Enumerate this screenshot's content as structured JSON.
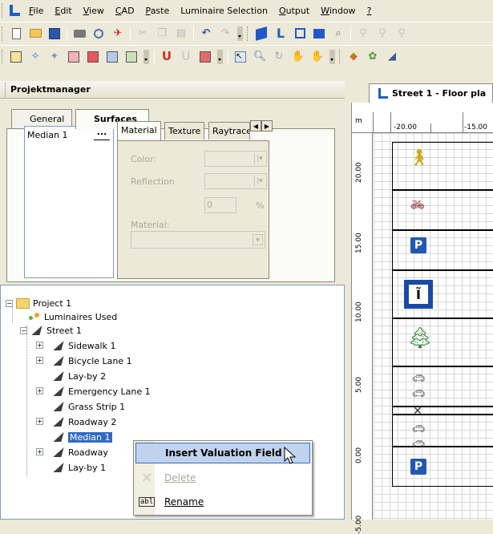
{
  "menu": {
    "items": [
      {
        "label": "File",
        "ul": "F",
        "rest": "ile"
      },
      {
        "label": "Edit",
        "ul": "E",
        "rest": "dit"
      },
      {
        "label": "View",
        "ul": "V",
        "rest": "iew"
      },
      {
        "label": "CAD",
        "ul": "C",
        "rest": "AD"
      },
      {
        "label": "Paste",
        "ul": "P",
        "rest": "aste"
      },
      {
        "label": "Luminaire Selection",
        "ul": "",
        "rest": "Luminaire Selection"
      },
      {
        "label": "Output",
        "ul": "O",
        "rest": "utput"
      },
      {
        "label": "Window",
        "ul": "W",
        "rest": "indow"
      },
      {
        "label": "?",
        "ul": "?",
        "rest": ""
      }
    ]
  },
  "panel": {
    "title": "Projektmanager",
    "tabs": {
      "general": "General",
      "surfaces": "Surfaces"
    },
    "surface_list": {
      "selected": "Median 1",
      "browse": "..."
    },
    "inner_tabs": {
      "material": "Material",
      "texture": "Texture",
      "raytracer": "Raytracer"
    },
    "fields": {
      "color_label": "Color:",
      "reflection_label": "Reflection",
      "reflection_value": "0",
      "percent": "%",
      "material_label": "Material:"
    }
  },
  "tree": {
    "project": "Project 1",
    "luminaires": "Luminaires Used",
    "street": "Street 1",
    "children": [
      {
        "label": "Sidewalk 1",
        "expandable": true
      },
      {
        "label": "Bicycle Lane 1",
        "expandable": true
      },
      {
        "label": "Lay-by 2",
        "expandable": false
      },
      {
        "label": "Emergency Lane 1",
        "expandable": true
      },
      {
        "label": "Grass Strip 1",
        "expandable": false
      },
      {
        "label": "Roadway 2",
        "expandable": true
      },
      {
        "label": "Median 1",
        "expandable": false,
        "selected": true
      },
      {
        "label": "Roadway",
        "expandable": true
      },
      {
        "label": "Lay-by 1",
        "expandable": false
      }
    ]
  },
  "context_menu": {
    "insert": "Insert Valuation Field",
    "delete": "Delete",
    "rename": "Rename"
  },
  "document": {
    "tab_title": "Street 1 - Floor pla",
    "units": "m",
    "x_ticks": [
      "-20.00",
      "-15.00"
    ],
    "y_ticks": [
      "20.00",
      "15.00",
      "10.00",
      "5.00",
      "0.00",
      "-5.00"
    ]
  }
}
